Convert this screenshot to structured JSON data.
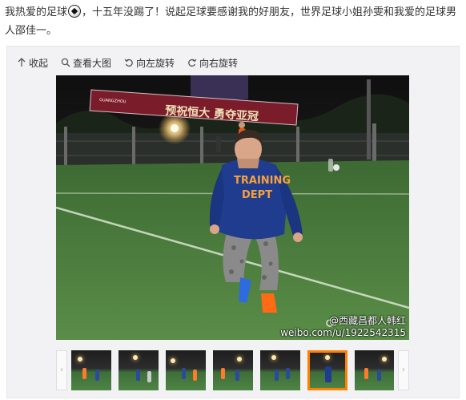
{
  "post": {
    "text_part1": "我热爱的足球",
    "emoji_name": "soccer-ball-icon",
    "text_part2": "，十五年没踢了！说起足球要感谢我的好朋友，世界足球小姐孙雯和我爱的足球男人邵佳一。"
  },
  "toolbar": {
    "collapse_label": "收起",
    "view_large_label": "查看大图",
    "rotate_left_label": "向左旋转",
    "rotate_right_label": "向右旋转"
  },
  "photo": {
    "banner_left_text": "GUANGZHOU",
    "banner_text": "预祝恒大 勇夺亚冠",
    "sweatshirt_line1": "TRAINING",
    "sweatshirt_line2": "DEPT",
    "watermark_handle": "@西藏昌都人韩红",
    "watermark_url": "weibo.com/u/1922542315"
  },
  "thumbnails": {
    "left_arrow_icon": "chevron-left-icon",
    "right_arrow_icon": "chevron-right-icon",
    "count": 7,
    "selected_index": 5
  },
  "colors": {
    "selection": "#ff8000",
    "sweatshirt": "#1f3c8f",
    "pitch": "#4a7e3c"
  }
}
